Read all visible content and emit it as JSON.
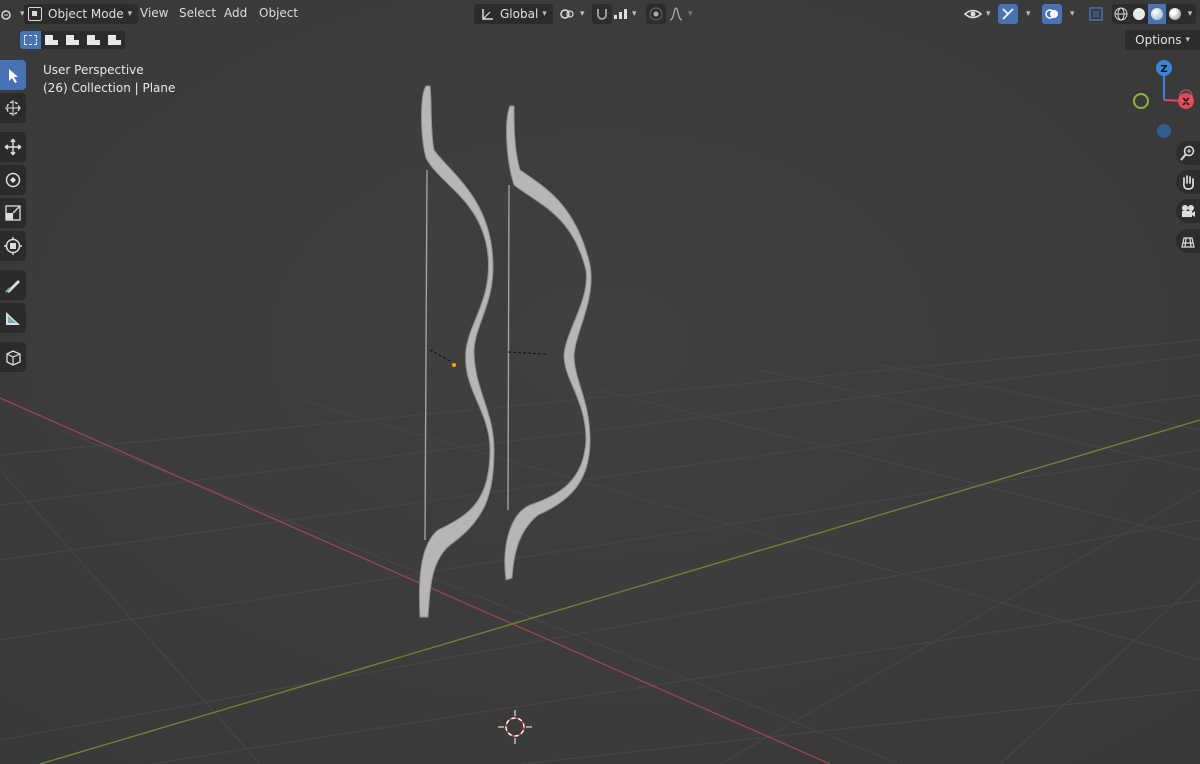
{
  "header": {
    "mode_label": "Object Mode",
    "menu": [
      "View",
      "Select",
      "Add",
      "Object"
    ],
    "orientation_label": "Global"
  },
  "options_label": "Options",
  "viewport": {
    "view_name": "User Perspective",
    "collection_info": "(26) Collection | Plane"
  },
  "gizmo": {
    "z_label": "Z",
    "x_label": "X"
  },
  "colors": {
    "background": "#3d3d3d",
    "accent": "#4772b3",
    "x_axis": "#e04a5b",
    "y_axis": "#8fb732",
    "z_axis": "#3b84d8",
    "mesh": "#b8b8b8"
  },
  "toolbar_icons": [
    "select-box-icon",
    "cursor-icon",
    "move-icon",
    "rotate-icon",
    "scale-icon",
    "transform-icon",
    "annotate-icon",
    "measure-icon",
    "add-cube-icon"
  ],
  "nav_icons": [
    "zoom-icon",
    "hand-pan-icon",
    "camera-icon",
    "grid-view-icon"
  ]
}
